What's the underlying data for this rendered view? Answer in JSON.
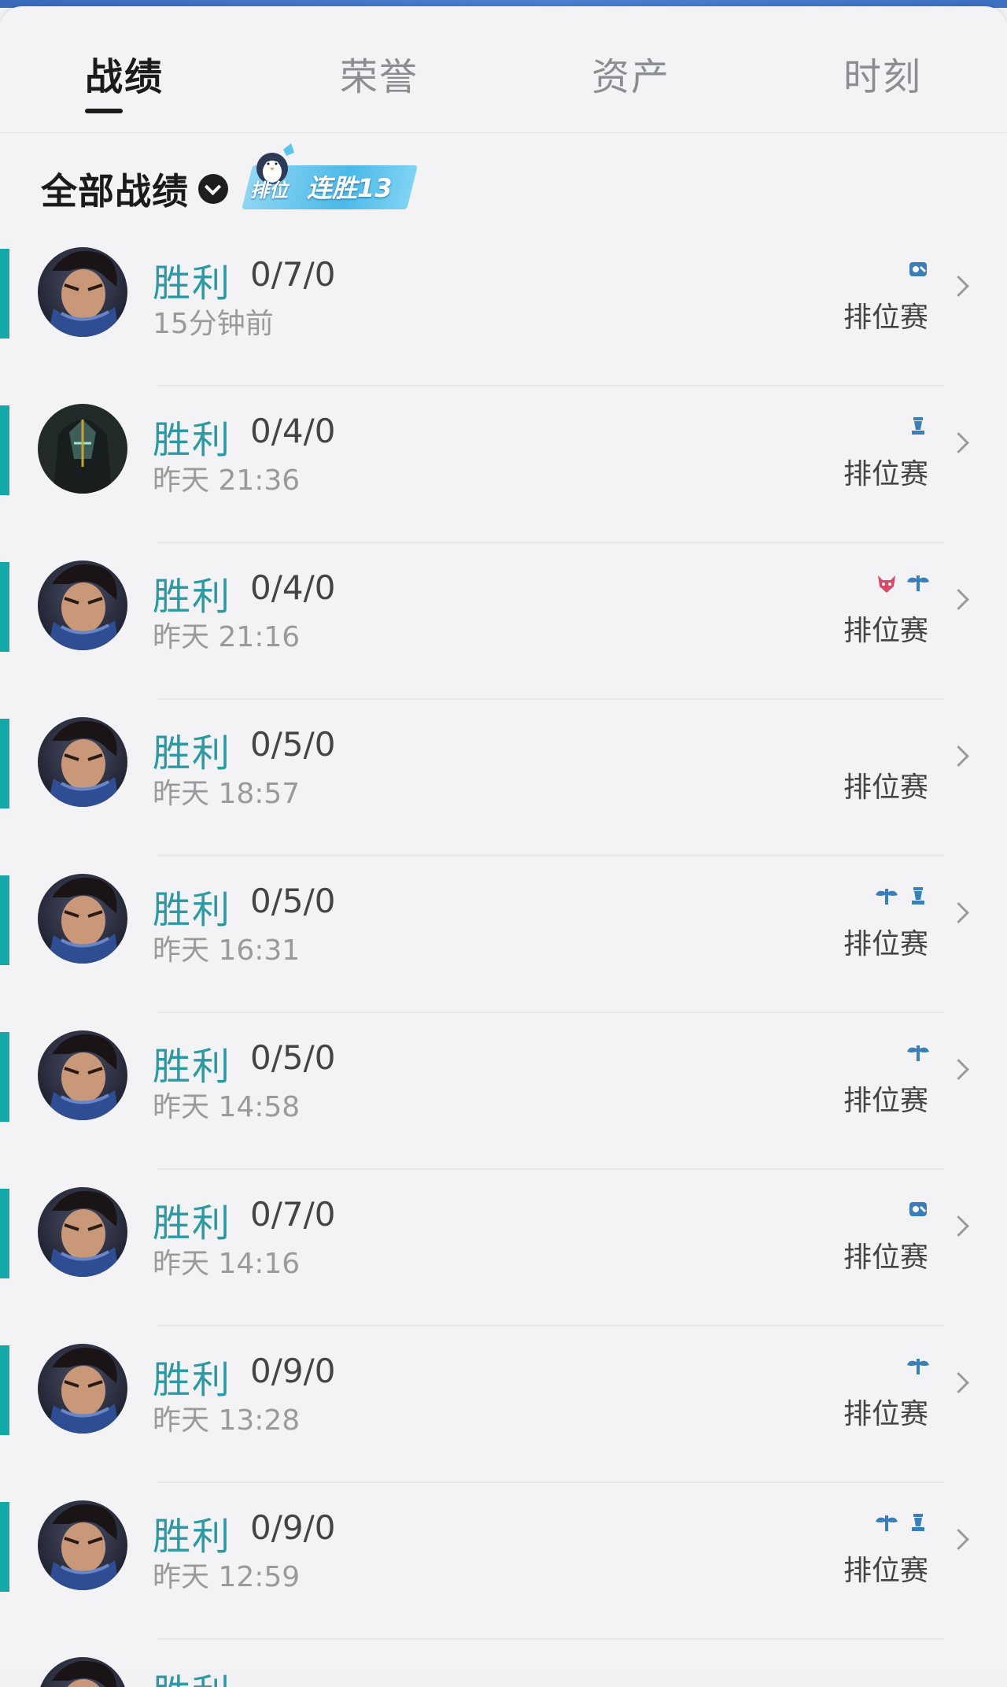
{
  "tabs": [
    {
      "label": "战绩",
      "active": true
    },
    {
      "label": "荣誉",
      "active": false
    },
    {
      "label": "资产",
      "active": false
    },
    {
      "label": "时刻",
      "active": false
    }
  ],
  "filter": {
    "label": "全部战绩"
  },
  "streak_badge": {
    "rank_label": "排位",
    "text": "连胜13"
  },
  "colors": {
    "accent": "#14a8a8",
    "result_text": "#2b9aa4"
  },
  "matches": [
    {
      "result": "胜利",
      "kda": "0/7/0",
      "time": "15分钟前",
      "mode": "排位赛",
      "icons": [
        "shield-icon"
      ]
    },
    {
      "result": "胜利",
      "kda": "0/4/0",
      "time": "昨天 21:36",
      "mode": "排位赛",
      "icons": [
        "chess-piece-icon"
      ]
    },
    {
      "result": "胜利",
      "kda": "0/4/0",
      "time": "昨天 21:16",
      "mode": "排位赛",
      "icons": [
        "demon-icon",
        "wings-icon"
      ]
    },
    {
      "result": "胜利",
      "kda": "0/5/0",
      "time": "昨天 18:57",
      "mode": "排位赛",
      "icons": []
    },
    {
      "result": "胜利",
      "kda": "0/5/0",
      "time": "昨天 16:31",
      "mode": "排位赛",
      "icons": [
        "wings-icon",
        "chess-piece-icon"
      ]
    },
    {
      "result": "胜利",
      "kda": "0/5/0",
      "time": "昨天 14:58",
      "mode": "排位赛",
      "icons": [
        "wings-icon"
      ]
    },
    {
      "result": "胜利",
      "kda": "0/7/0",
      "time": "昨天 14:16",
      "mode": "排位赛",
      "icons": [
        "shield-icon"
      ]
    },
    {
      "result": "胜利",
      "kda": "0/9/0",
      "time": "昨天 13:28",
      "mode": "排位赛",
      "icons": [
        "wings-icon"
      ]
    },
    {
      "result": "胜利",
      "kda": "0/9/0",
      "time": "昨天 12:59",
      "mode": "排位赛",
      "icons": [
        "wings-icon",
        "chess-piece-icon"
      ]
    }
  ],
  "partial_match": {
    "result": "胜利"
  }
}
